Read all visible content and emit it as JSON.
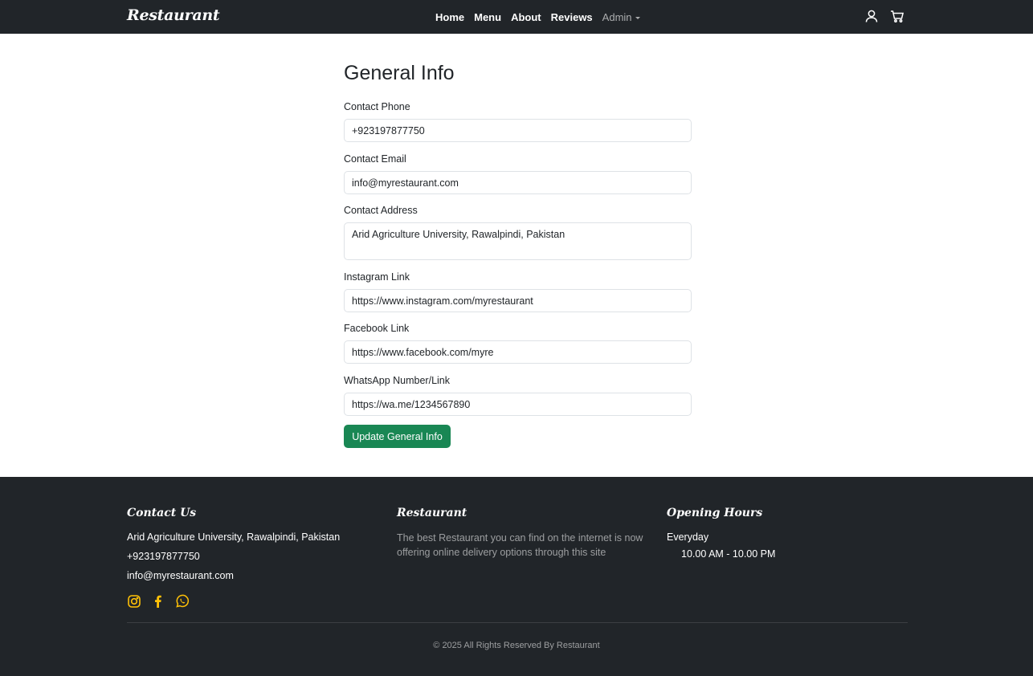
{
  "navbar": {
    "brand": "Restaurant",
    "links": [
      {
        "label": "Home"
      },
      {
        "label": "Menu"
      },
      {
        "label": "About"
      },
      {
        "label": "Reviews"
      },
      {
        "label": "Admin"
      }
    ],
    "icons": [
      "user-icon",
      "cart-icon"
    ]
  },
  "form": {
    "title": "General Info",
    "fields": {
      "phone": {
        "label": "Contact Phone",
        "value": "+923197877750"
      },
      "email": {
        "label": "Contact Email",
        "value": "info@myrestaurant.com"
      },
      "address": {
        "label": "Contact Address",
        "value": "Arid Agriculture University, Rawalpindi, Pakistan"
      },
      "instagram": {
        "label": "Instagram Link",
        "value": "https://www.instagram.com/myrestaurant"
      },
      "facebook": {
        "label": "Facebook Link",
        "value": "https://www.facebook.com/myre"
      },
      "whatsapp": {
        "label": "WhatsApp Number/Link",
        "value": "https://wa.me/1234567890"
      }
    },
    "submit_label": "Update General Info"
  },
  "footer": {
    "contact": {
      "heading": "Contact Us",
      "address": "Arid Agriculture University, Rawalpindi, Pakistan",
      "phone": "+923197877750",
      "email": "info@myrestaurant.com",
      "social_icons": [
        "instagram-icon",
        "facebook-icon",
        "whatsapp-icon"
      ]
    },
    "about": {
      "heading": "Restaurant",
      "description": "The best Restaurant you can find on the internet is now offering online delivery options through this site"
    },
    "hours": {
      "heading": "Opening Hours",
      "days": "Everyday",
      "time": "10.00 AM - 10.00 PM"
    },
    "copyright": "© 2025 All Rights Reserved By Restaurant"
  },
  "colors": {
    "dark": "#212529",
    "accent_green": "#198754",
    "social_yellow": "#ffc107"
  }
}
